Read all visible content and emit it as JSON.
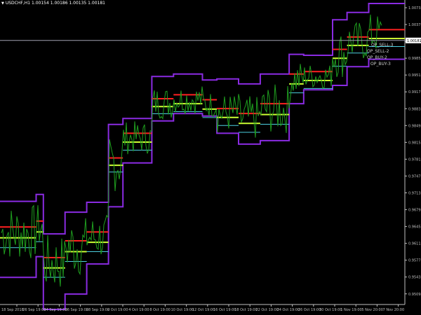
{
  "header": {
    "symbol_timeframe": "USDCHF,H1",
    "ohlc": "1.00154 1.00186 1.00135 1.00181"
  },
  "price_axis": {
    "ticks": [
      "1.00735",
      "1.00375",
      "1.00203",
      "0.99855",
      "0.99515",
      "0.99175",
      "0.98835",
      "0.98495",
      "0.98155",
      "0.97815",
      "0.97475",
      "0.97135",
      "0.96795",
      "0.96455",
      "0.96115",
      "0.95775",
      "0.95435",
      "0.95095"
    ],
    "current_price": "1.00181"
  },
  "time_axis": {
    "labels": [
      "18 Sep 2018",
      "26 Sep 19:00",
      "24 Sep 19:00",
      "26 Sep 19:00",
      "28 Sep 19:00",
      "2 Oct 19:00",
      "4 Oct 19:00",
      "8 Oct 19:00",
      "10 Oct 19:00",
      "12 Oct 19:00",
      "16 Oct 19:00",
      "18 Oct 19:00",
      "22 Oct 19:00",
      "24 Oct 19:00",
      "26 Oct 19:00",
      "30 Oct 19:00",
      "1 Nov 19:00",
      "5 Nov 20:00",
      "7 Nov 20:00"
    ]
  },
  "level_labels": [
    "OP_SELL-3",
    "OP_SELL-2",
    "OP_BUY-2",
    "OP_BUY-3"
  ],
  "colors": {
    "background": "#000000",
    "axis": "#c0c0c0",
    "price_line": "#1f9e1f",
    "envelope": "#8a2be2",
    "red_level": "#ff2020",
    "yellow_level": "#ccff33",
    "cyan_level": "#4dd0e1"
  },
  "chart_data": {
    "type": "line",
    "price_range": [
      0.949,
      1.0093
    ],
    "blocks": [
      {
        "x": 0,
        "hi": 0.9692,
        "lo": 0.9538,
        "red": 0.964,
        "yel": 0.9618
      },
      {
        "x": 5,
        "hi": 0.9706,
        "lo": 0.958,
        "red": 0.9652,
        "yel": 0.963
      },
      {
        "x": 6,
        "hi": 0.9626,
        "lo": 0.9473,
        "red": 0.9578,
        "yel": 0.9557
      },
      {
        "x": 9,
        "hi": 0.967,
        "lo": 0.9504,
        "red": 0.9612,
        "yel": 0.959
      },
      {
        "x": 12,
        "hi": 0.969,
        "lo": 0.9565,
        "red": 0.963,
        "yel": 0.9609
      },
      {
        "x": 15,
        "hi": 0.9848,
        "lo": 0.9681,
        "red": 0.978,
        "yel": 0.9765
      },
      {
        "x": 17,
        "hi": 0.986,
        "lo": 0.977,
        "red": 0.983,
        "yel": 0.9812
      },
      {
        "x": 21,
        "hi": 0.9945,
        "lo": 0.9855,
        "red": 0.99,
        "yel": 0.9884
      },
      {
        "x": 24,
        "hi": 0.995,
        "lo": 0.987,
        "red": 0.9908,
        "yel": 0.989
      },
      {
        "x": 28,
        "hi": 0.9938,
        "lo": 0.9865,
        "red": 0.9898,
        "yel": 0.9879
      },
      {
        "x": 30,
        "hi": 0.994,
        "lo": 0.983,
        "red": 0.988,
        "yel": 0.9862
      },
      {
        "x": 33,
        "hi": 0.993,
        "lo": 0.9808,
        "red": 0.987,
        "yel": 0.985
      },
      {
        "x": 36,
        "hi": 0.995,
        "lo": 0.9815,
        "red": 0.989,
        "yel": 0.9868
      },
      {
        "x": 40,
        "hi": 0.999,
        "lo": 0.989,
        "red": 0.995,
        "yel": 0.993
      },
      {
        "x": 42,
        "hi": 0.9988,
        "lo": 0.9918,
        "red": 0.9955,
        "yel": 0.9937
      },
      {
        "x": 46,
        "hi": 1.006,
        "lo": 0.9927,
        "red": 1.0,
        "yel": 0.9982
      },
      {
        "x": 48,
        "hi": 1.0075,
        "lo": 0.9965,
        "red": 1.0025,
        "yel": 1.0008
      },
      {
        "x": 51,
        "hi": 1.0093,
        "lo": 0.998,
        "red": 1.004,
        "yel": 1.0022
      }
    ]
  }
}
